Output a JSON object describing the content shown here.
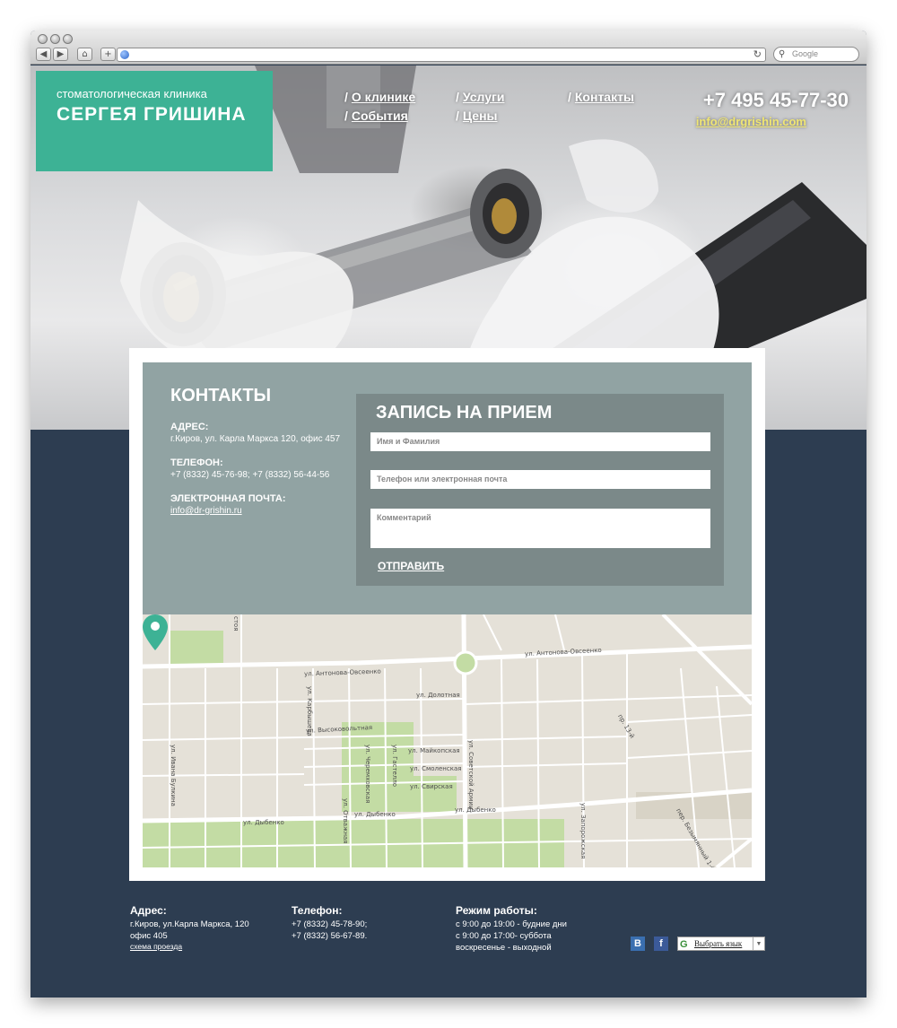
{
  "browser": {
    "search_placeholder": "Google"
  },
  "header": {
    "logo_sub": "стоматологическая клиника",
    "logo_main": "СЕРГЕЯ ГРИШИНА",
    "menu": [
      {
        "label": "О клинике"
      },
      {
        "label": "События"
      },
      {
        "label": "Услуги"
      },
      {
        "label": "Цены"
      },
      {
        "label": "Контакты"
      }
    ],
    "slash": "/",
    "phone": "+7 495 45-77-30",
    "email": "info@drgrishin.com"
  },
  "contacts": {
    "title": "КОНТАКТЫ",
    "address_label": "АДРЕС:",
    "address_value": "г.Киров, ул. Карла Маркса 120, офис 457",
    "phone_label": "ТЕЛЕФОН:",
    "phone_value": "+7 (8332) 45-76-98; +7 (8332) 56-44-56",
    "email_label": "ЭЛЕКТРОННАЯ ПОЧТА:",
    "email_value": "info@dr-grishin.ru"
  },
  "form": {
    "title": "ЗАПИСЬ НА ПРИЕМ",
    "name_placeholder": "Имя и Фамилия",
    "contact_placeholder": "Телефон или электронная почта",
    "comment_placeholder": "Комментарий",
    "submit_label": "ОТПРАВИТЬ"
  },
  "map": {
    "streets": {
      "antonova_1": "ул. Антонова-Овсеенко",
      "antonova_2": "ул. Антонова-Овсеенко",
      "dolotnaya": "ул. Долотная",
      "vysokovoltnaya": "ул. Высоковольтная",
      "maykopskaya": "ул. Майкопская",
      "smolenskaya": "ул. Смоленская",
      "svirskaya": "ул. Свирская",
      "dybenko_1": "ул. Дыбенко",
      "dybenko_2": "ул. Дыбенко",
      "dybenko_3": "ул. Дыбенко",
      "sovetskoy_armii": "ул. Советской Армии",
      "zaporozhskaya": "ул. Запорожская",
      "bulkina": "ул. Ивана Булкина",
      "otvazhnaya": "ул. Отважная",
      "cheremkhovskaya": "ул. Черемховская",
      "gastello": "ул. Гастелло",
      "karbysheva": "ул. Карбышева",
      "bezymyanny": "пер. Безымянный 1-й",
      "pr13": "пр. 13-й",
      "stoya": "стоя"
    }
  },
  "footer": {
    "address_title": "Адрес:",
    "address_line1": "г.Киров, ул.Карла Маркса, 120",
    "address_line2": "офис 405",
    "route_link": "схема проезда",
    "phone_title": "Телефон:",
    "phone_line1": "+7 (8332) 45-78-90;",
    "phone_line2": "+7 (8332) 56-67-89.",
    "hours_title": "Режим работы:",
    "hours_line1": "с 9:00 до 19:00 - будние дни",
    "hours_line2": "с 9:00 до 17:00- суббота",
    "hours_line3": "воскресенье - выходной",
    "vk": "В",
    "fb": "f",
    "lang_label": "Выбрать язык"
  },
  "colors": {
    "accent": "#3db295",
    "footer_bg": "#2d3d51",
    "panel": "#91a3a3",
    "form_bg": "#7b8989",
    "email_highlight": "#f0e672"
  }
}
